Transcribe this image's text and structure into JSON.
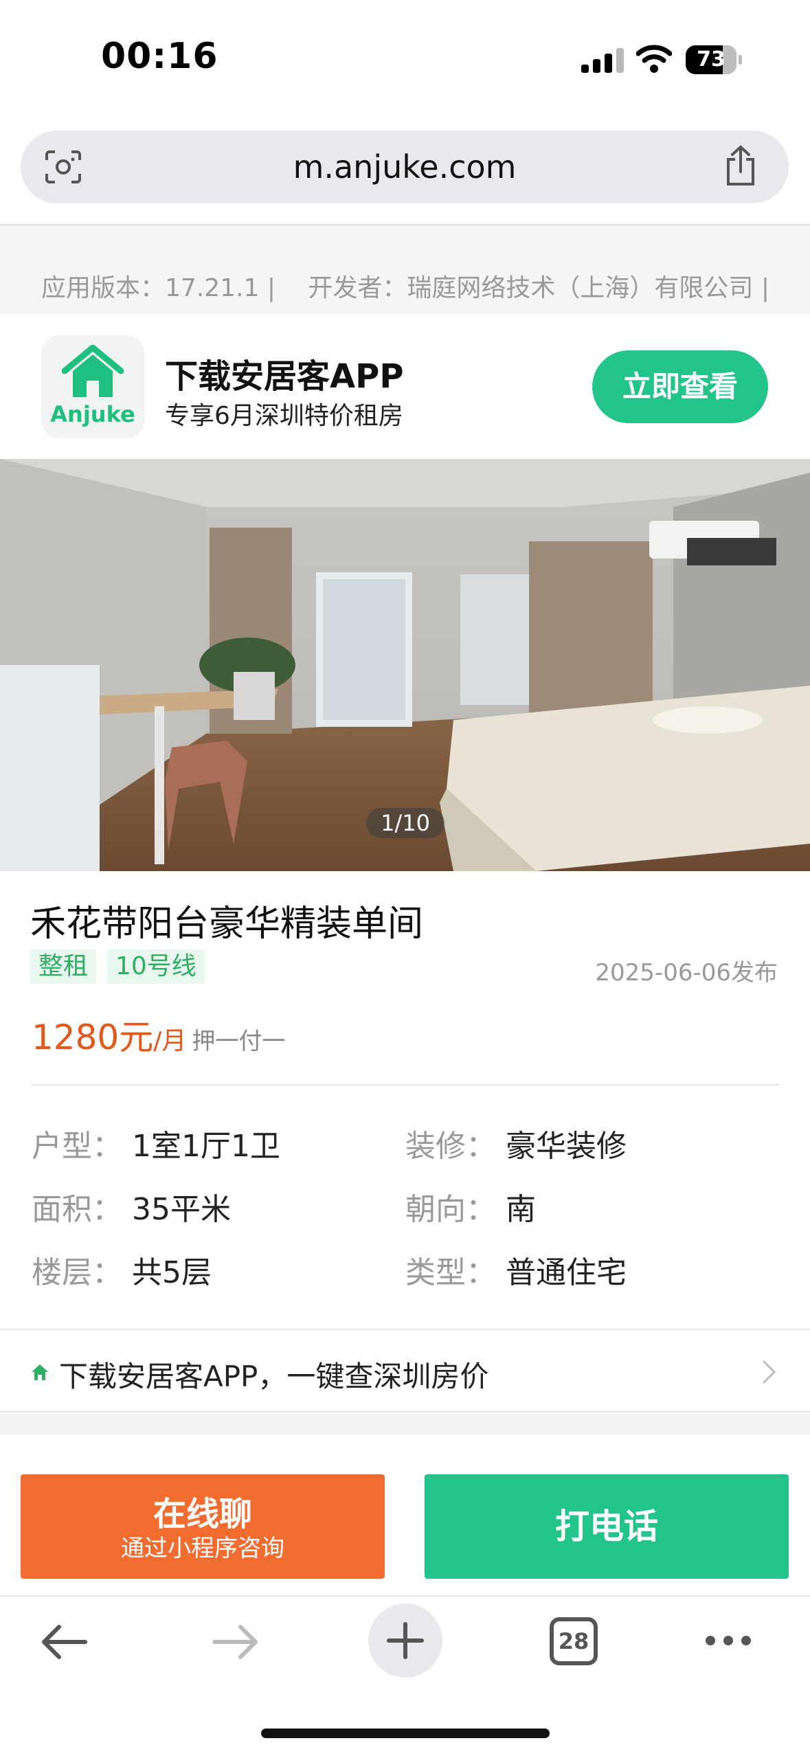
{
  "status_bar": {
    "time": "00:16",
    "battery": "73"
  },
  "browser": {
    "url": "m.anjuke.com",
    "tab_count": "28"
  },
  "app_info": {
    "text": "应用版本：17.21.1 | 　开发者：瑞庭网络技术（上海）有限公司 |"
  },
  "banner": {
    "logo_text": "Anjuke",
    "title": "下载安居客APP",
    "subtitle": "专享6月深圳特价租房",
    "button": "立即查看"
  },
  "gallery": {
    "counter": "1/10"
  },
  "listing": {
    "title": "禾花带阳台豪华精装单间",
    "tags": [
      "整租",
      "10号线"
    ],
    "date": "2025-06-06发布",
    "price": "1280元",
    "price_unit": "/月",
    "deposit": "押一付一",
    "attributes": [
      {
        "label": "户型",
        "value": "1室1厅1卫"
      },
      {
        "label": "装修",
        "value": "豪华装修"
      },
      {
        "label": "面积",
        "value": "35平米"
      },
      {
        "label": "朝向",
        "value": "南"
      },
      {
        "label": "楼层",
        "value": "共5层"
      },
      {
        "label": "类型",
        "value": "普通住宅"
      }
    ],
    "colon": "："
  },
  "download_strip": {
    "text": "下载安居客APP，一键查深圳房价"
  },
  "actions": {
    "chat_main": "在线聊",
    "chat_sub": "通过小程序咨询",
    "call": "打电话"
  },
  "colors": {
    "green": "#23c48a",
    "orange": "#f26c2f",
    "price": "#e4571b"
  }
}
